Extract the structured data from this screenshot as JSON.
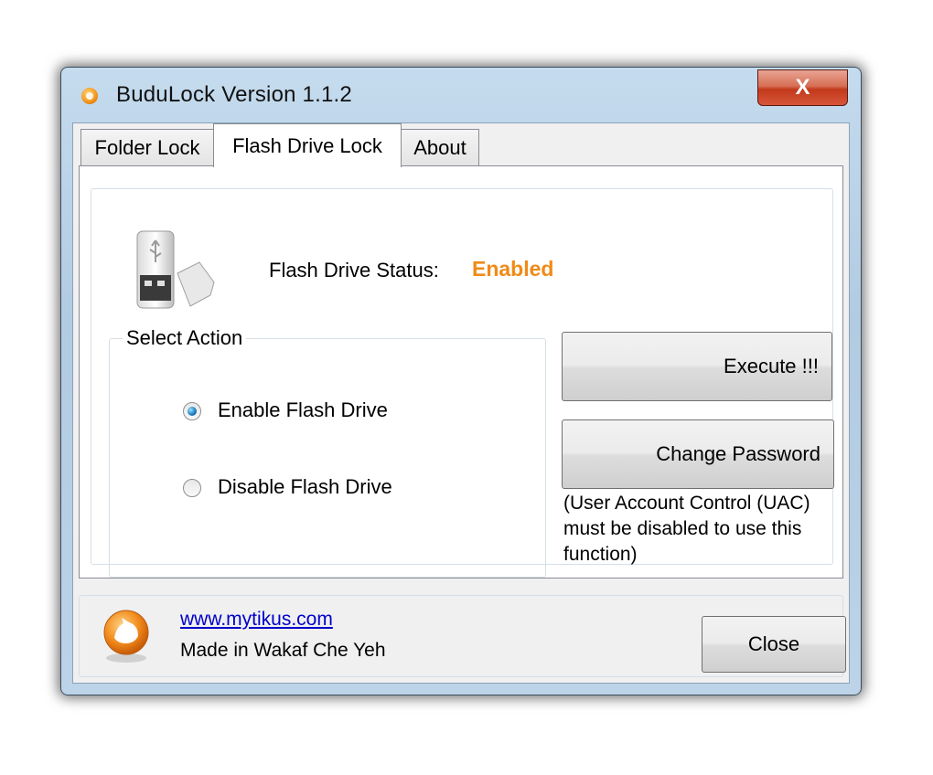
{
  "window": {
    "title": "BuduLock Version 1.1.2",
    "close_glyph": "X"
  },
  "tabs": [
    {
      "label": "Folder Lock",
      "active": false
    },
    {
      "label": "Flash Drive Lock",
      "active": true
    },
    {
      "label": "About",
      "active": false
    }
  ],
  "status": {
    "label": "Flash Drive Status:",
    "value": "Enabled",
    "value_color": "#f08a18"
  },
  "action_group": {
    "legend": "Select Action",
    "options": [
      {
        "label": "Enable Flash Drive",
        "checked": true
      },
      {
        "label": "Disable Flash Drive",
        "checked": false
      }
    ]
  },
  "buttons": {
    "execute": "Execute !!!",
    "change_password": "Change Password",
    "close": "Close"
  },
  "uac_note": "(User Account Control (UAC) must be disabled to use this function)",
  "footer": {
    "link": "www.mytikus.com",
    "made_in": "Made in Wakaf Che Yeh"
  },
  "icons": {
    "app": "budulock-app-icon",
    "usb": "usb-flash-drive-icon",
    "logo": "mytikus-logo-icon"
  }
}
